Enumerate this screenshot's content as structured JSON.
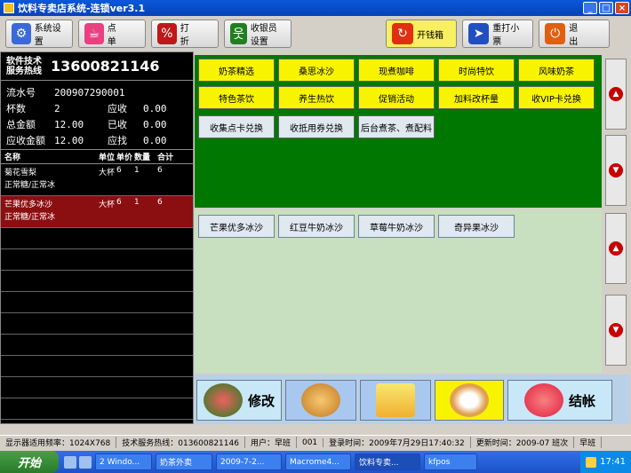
{
  "window": {
    "title": "饮料专卖店系统-连锁ver3.1"
  },
  "toolbar": {
    "system_settings": "系统设置",
    "order": "点　　单",
    "discount": "打　　折",
    "cashier_settings": "收银员设置",
    "open_drawer": "开钱箱",
    "reprint": "重打小票",
    "exit": "退　　出"
  },
  "hotline": {
    "label": "软件技术服务热线",
    "number": "13600821146"
  },
  "order_info": {
    "serial_label": "流水号",
    "serial_value": "200907290001",
    "cups_label": "杯数",
    "cups_value": "2",
    "receivable_label": "应收",
    "receivable_value": "0.00",
    "total_label": "总金额",
    "total_value": "12.00",
    "received_label": "已收",
    "received_value": "0.00",
    "due_label": "应收金额",
    "due_value": "12.00",
    "change_label": "应找",
    "change_value": "0.00"
  },
  "order_grid": {
    "headers": {
      "name": "名称",
      "unit": "单位",
      "price": "单价",
      "qty": "数量",
      "total": "合计"
    },
    "rows": [
      {
        "name": "菊花雪梨",
        "unit": "大杯",
        "price": "6",
        "qty": "1",
        "total": "6",
        "note": "正常糖/正常冰"
      },
      {
        "name": "芒果优多冰沙",
        "unit": "大杯",
        "price": "6",
        "qty": "1",
        "total": "6",
        "note": "正常糖/正常冰"
      }
    ]
  },
  "categories": [
    "奶茶精选",
    "桑思冰沙",
    "现煮咖啡",
    "时尚特饮",
    "风味奶茶",
    "特色茶饮",
    "养生热饮",
    "促销活动",
    "加料改杯量",
    "收VIP卡兑换",
    "收集点卡兑换",
    "收抵用券兑换",
    "后台煮茶、煮配料"
  ],
  "items": [
    "芒果优多冰沙",
    "红豆牛奶冰沙",
    "草莓牛奶冰沙",
    "奇异果冰沙"
  ],
  "actions": {
    "modify": "修改",
    "checkout": "结帐"
  },
  "status": {
    "resolution": "显示器适用频率：1024X768",
    "service": "技术服务热线：013600821146",
    "user": "用户：早班",
    "user_code": "001",
    "login": "登录时间：2009年7月29日17:40:32",
    "update": "更新时间：2009-07 班次",
    "shift": "早班"
  },
  "taskbar": {
    "start": "开始",
    "tasks": [
      "2 Windo...",
      "奶茶外卖",
      "2009-7-2...",
      "Macrome4...",
      "饮料专卖...",
      "kfpos"
    ],
    "clock": "17:41"
  }
}
